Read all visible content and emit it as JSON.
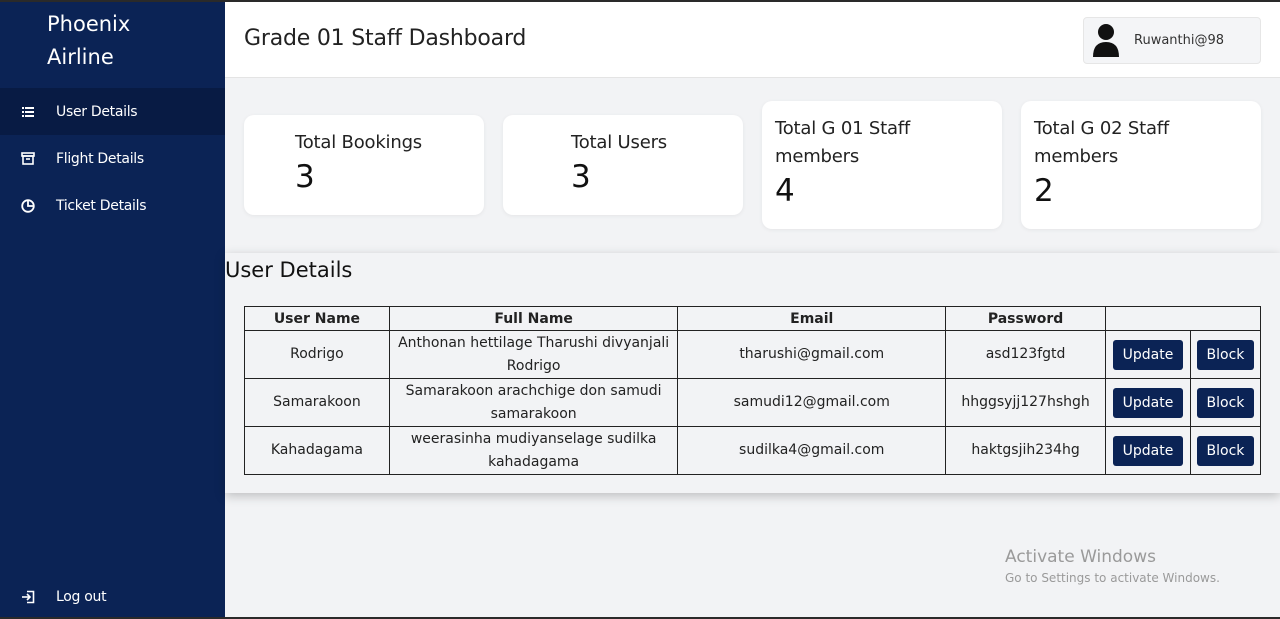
{
  "sidebar": {
    "brand": "Phoenix\nAirline",
    "items": [
      {
        "label": "User Details",
        "icon": "list-icon",
        "active": true
      },
      {
        "label": "Flight Details",
        "icon": "archive-icon",
        "active": false
      },
      {
        "label": "Ticket Details",
        "icon": "pie-chart-icon",
        "active": false
      }
    ],
    "logout_label": "Log out"
  },
  "header": {
    "title": "Grade 01 Staff Dashboard",
    "username": "Ruwanthi@98"
  },
  "stats": [
    {
      "label": "Total Bookings",
      "value": "3"
    },
    {
      "label": "Total Users",
      "value": "3"
    },
    {
      "label": "Total G 01 Staff members",
      "value": "4"
    },
    {
      "label": "Total G 02 Staff members",
      "value": "2"
    }
  ],
  "user_details": {
    "title": "User Details",
    "columns": [
      "User Name",
      "Full Name",
      "Email",
      "Password",
      ""
    ],
    "rows": [
      {
        "username": "Rodrigo",
        "full_name": "Anthonan hettilage Tharushi divyanjali Rodrigo",
        "email": "tharushi@gmail.com",
        "password": "asd123fgtd"
      },
      {
        "username": "Samarakoon",
        "full_name": "Samarakoon arachchige don samudi samarakoon",
        "email": "samudi12@gmail.com",
        "password": "hhggsyjj127hshgh"
      },
      {
        "username": "Kahadagama",
        "full_name": "weerasinha mudiyanselage sudilka kahadagama",
        "email": "sudilka4@gmail.com",
        "password": "haktgsjih234hg"
      }
    ],
    "update_label": "Update",
    "block_label": "Block"
  },
  "watermark": {
    "line1": "Activate Windows",
    "line2": "Go to Settings to activate Windows."
  },
  "colors": {
    "sidebar": "#0b2355",
    "button": "#0b2355",
    "background": "#f2f3f5"
  }
}
